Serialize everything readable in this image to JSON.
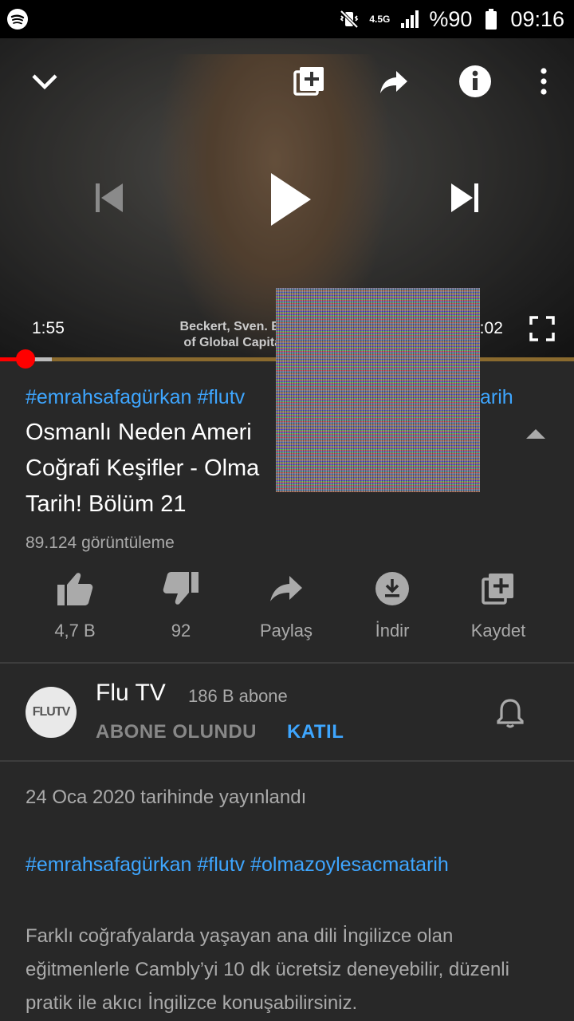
{
  "status_bar": {
    "network": "4.5G",
    "battery": "%90",
    "time": "09:16"
  },
  "player": {
    "current_time": "1:55",
    "duration": "3:02",
    "caption_line1": "Beckert, Sven. Empire",
    "caption_line2": "of Global Capitalism.",
    "progress_played_fraction": 0.044,
    "progress_buffered_fraction": 0.09
  },
  "video": {
    "hashtags": "#emrahsafagürkan #flutv",
    "hashtags_tail": "arih",
    "title_line1": "Osmanlı Neden Ameri",
    "title_line2": "Coğrafi Keşifler - Olma",
    "title_line3": "Tarih! Bölüm 21",
    "views": "89.124 görüntüleme"
  },
  "actions": {
    "like_count": "4,7 B",
    "dislike_count": "92",
    "share_label": "Paylaş",
    "download_label": "İndir",
    "save_label": "Kaydet"
  },
  "channel": {
    "avatar_text": "FLUTV",
    "name": "Flu TV",
    "subscribers": "186 B abone",
    "subscribed_label": "ABONE OLUNDU",
    "join_label": "KATIL"
  },
  "description": {
    "published": "24 Oca 2020 tarihinde yayınlandı",
    "hashtags": "#emrahsafagürkan #flutv #olmazoylesacmatarih",
    "text": "Farklı coğrafyalarda yaşayan ana dili İngilizce olan eğitmenlerle Cambly’yi 10 dk ücretsiz deneyebilir, düzenli pratik ile akıcı İngilizce konuşabilirsiniz."
  },
  "colors": {
    "accent_blue": "#3ea6ff",
    "progress_red": "#ff0000",
    "background": "#282828"
  }
}
